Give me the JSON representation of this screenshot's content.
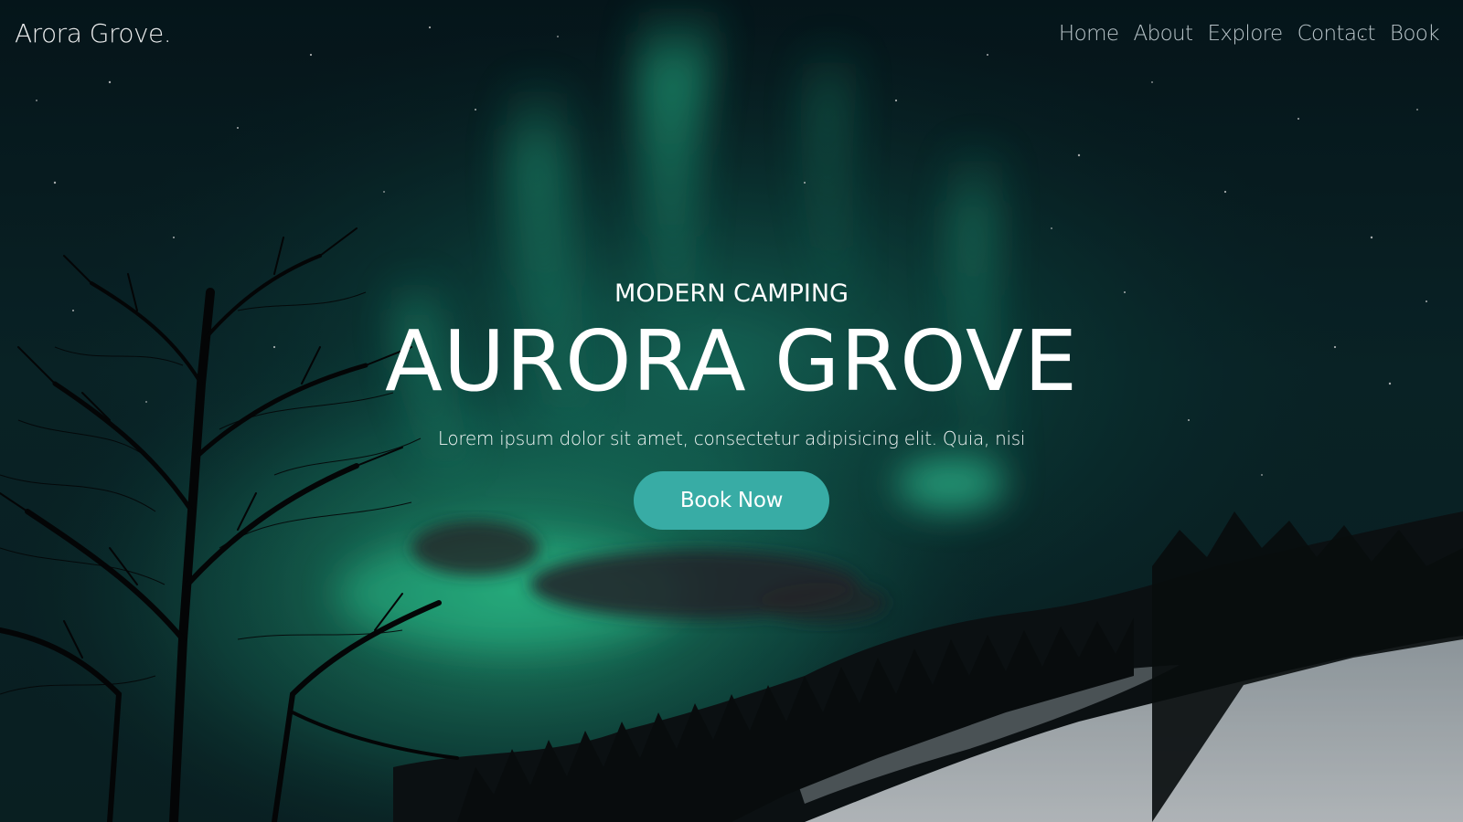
{
  "navbar": {
    "brand": "Arora Grove.",
    "links": [
      "Home",
      "About",
      "Explore",
      "Contact",
      "Book"
    ]
  },
  "hero": {
    "kicker": "MODERN CAMPING",
    "title": "AURORA GROVE",
    "subtitle": "Lorem ipsum dolor sit amet, consectetur adipisicing elit. Quia, nisi",
    "cta_label": "Book Now"
  },
  "colors": {
    "sky_dark": "#06141b",
    "aurora_green": "#2ee6a6",
    "cta_teal": "#38aca5",
    "snow": "#c8d0d6"
  }
}
